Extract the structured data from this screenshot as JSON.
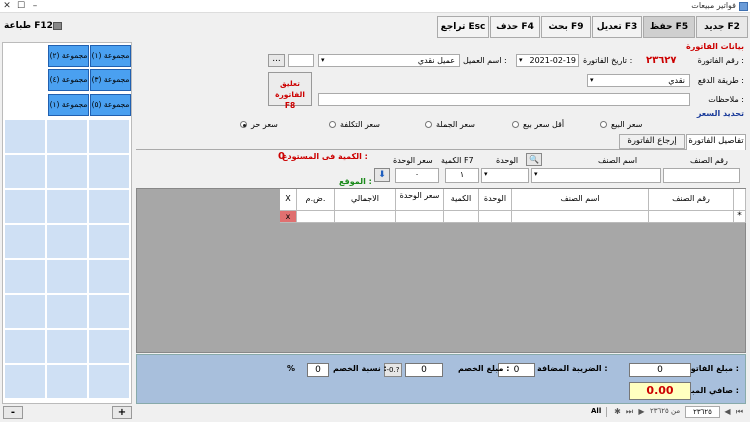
{
  "window": {
    "title": "فواتير مبيعات"
  },
  "toolbar": {
    "new": "جديد F2",
    "save": "حفظ F5",
    "edit": "تعديل F3",
    "search": "بحث F9",
    "delete": "حذف F4",
    "back": "تراجع Esc",
    "print": "طباعة F12"
  },
  "invoice": {
    "section_title": "بيانات الفاتورة",
    "number_label": "رقم الفاتورة :",
    "number_value": "٢٣٦٢٧",
    "date_label": "تاريخ الفاتورة :",
    "date_value": "2021-02-19",
    "customer_label": "اسم العميل :",
    "customer_value": "عميل نقدي",
    "customer_btn": "...",
    "payment_label": "طريقة الدفع :",
    "payment_value": "نقدي",
    "notes_label": "ملاحظات :",
    "suspend_line1": "تعليق الفاتورة",
    "suspend_line2": "F8",
    "price_section": "تحديد السعر"
  },
  "price_options": [
    {
      "label": "سعر البيع",
      "checked": false
    },
    {
      "label": "أقل سعر بيع",
      "checked": false
    },
    {
      "label": "سعر الجملة",
      "checked": false
    },
    {
      "label": "سعر التكلفة",
      "checked": false
    },
    {
      "label": "سعر حر",
      "checked": true
    }
  ],
  "tabs": {
    "details": "تفاصيل الفاتورة",
    "returns": "إرجاع الفاتورة"
  },
  "entry": {
    "item_no_label": "رقم الصنف",
    "item_name_label": "اسم الصنف",
    "unit_label": "الوحدة",
    "qty_label": "الكمية F7",
    "unit_price_label": "سعر الوحدة",
    "qty_value": "١",
    "price_value": "٠",
    "stock_label": "الكمية فى المستودع :",
    "stock_value": "0",
    "location_label": "الموقع :"
  },
  "grid": {
    "columns": [
      "رقم الصنف",
      "اسم الصنف",
      "الوحدة",
      "الكمية",
      "سعر الوحدة",
      "الاجمالي",
      "ض.م.",
      "X"
    ],
    "delete_cell": "x",
    "row_marker": "*"
  },
  "totals": {
    "invoice_total_label": "مبلغ الفاتورة :",
    "invoice_total_value": "0",
    "vat_label": "الضريبة المضافة :",
    "vat_value": "0",
    "discount_amount_label": "مبلغ الخصم :",
    "discount_amount_value": "0",
    "discount_toggle": "-0.?",
    "discount_pct_label": "نسبة الخصم :",
    "discount_pct_value": "0",
    "pct_sign": "%",
    "net_label": "صافي المبلغ :",
    "net_value": "0.00"
  },
  "groups": [
    "مجموعة (٢)",
    "مجموعة (١)",
    "مجموعة (٤)",
    "مجموعة (٣)",
    "مجموعة (١)",
    "مجموعة (٥)"
  ],
  "left_buttons": {
    "plus": "+",
    "minus": "-"
  },
  "status": {
    "record_current": "٢٣٦٢٥",
    "record_of": "من ٢٣٦٢٥",
    "all": "All"
  },
  "colors": {
    "group_blue": "#4aa0f0",
    "cell_blue": "#cfe0f4",
    "panel_blue": "#a8bfdc",
    "net_yellow": "#ffffc0",
    "label_red": "#cc0000"
  }
}
